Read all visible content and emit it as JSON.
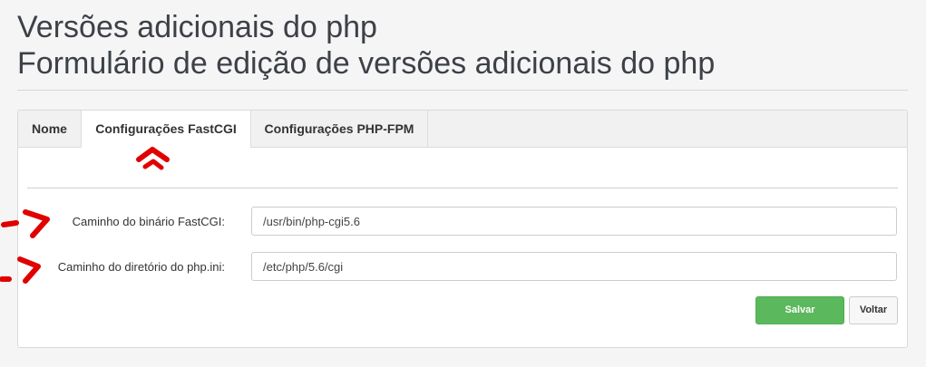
{
  "page": {
    "title": "Versões adicionais do php",
    "subtitle": "Formulário de edição de versões adicionais do php"
  },
  "tabs": [
    {
      "label": "Nome",
      "active": false
    },
    {
      "label": "Configurações FastCGI",
      "active": true
    },
    {
      "label": "Configurações PHP-FPM",
      "active": false
    }
  ],
  "form": {
    "binary_path": {
      "label": "Caminho do binário FastCGI:",
      "value": "/usr/bin/php-cgi5.6"
    },
    "ini_dir": {
      "label": "Caminho do diretório do php.ini:",
      "value": "/etc/php/5.6/cgi"
    }
  },
  "buttons": {
    "save": "Salvar",
    "back": "Voltar"
  },
  "colors": {
    "save": "#5cb85c",
    "annotation": "#e00000"
  }
}
